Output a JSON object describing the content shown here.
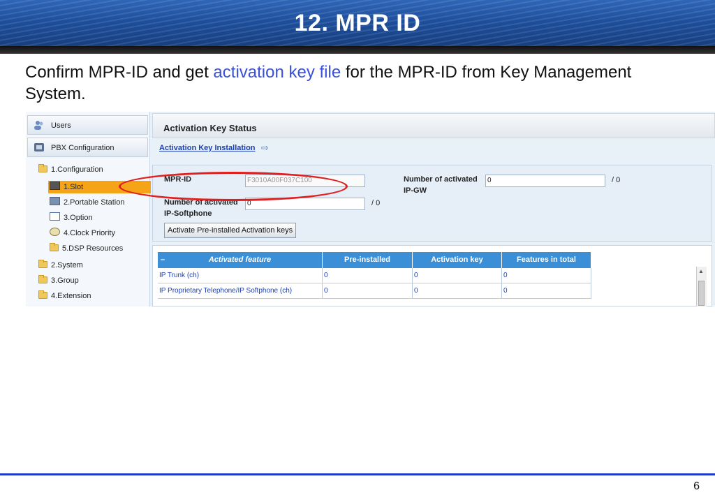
{
  "slide": {
    "title": "12. MPR ID",
    "intro_before": "Confirm MPR-ID and get ",
    "intro_highlight": "activation key file",
    "intro_after": " for the MPR-ID from Key Management System.",
    "page_number": "6"
  },
  "nav": {
    "users": "Users",
    "pbx_config": "PBX Configuration",
    "tree": [
      {
        "label": "1.Configuration",
        "icon": "folder-icon"
      },
      {
        "label": "1.Slot",
        "icon": "slot-icon",
        "selected": true
      },
      {
        "label": "2.Portable Station",
        "icon": "portable-station-icon"
      },
      {
        "label": "3.Option",
        "icon": "option-icon"
      },
      {
        "label": "4.Clock Priority",
        "icon": "clock-priority-icon"
      },
      {
        "label": "5.DSP Resources",
        "icon": "folder-icon"
      },
      {
        "label": "2.System",
        "icon": "folder-icon"
      },
      {
        "label": "3.Group",
        "icon": "folder-icon"
      },
      {
        "label": "4.Extension",
        "icon": "folder-icon"
      }
    ]
  },
  "main": {
    "section_title": "Activation Key Status",
    "install_link": "Activation Key Installation",
    "mpr_id_label": "MPR-ID",
    "mpr_id_value": "F3010A00F037C100",
    "ipgw_label_1": "Number of activated",
    "ipgw_label_2": "IP-GW",
    "ipgw_value": "0",
    "ipgw_total": "/ 0",
    "ipsoft_label_1": "Number of activated",
    "ipsoft_label_2": "IP-Softphone",
    "ipsoft_value": "0",
    "ipsoft_total": "/ 0",
    "activate_button": "Activate Pre-installed Activation keys",
    "table": {
      "headers": [
        "Activated feature",
        "Pre-installed",
        "Activation key",
        "Features in total"
      ],
      "rows": [
        [
          "IP Trunk (ch)",
          "0",
          "0",
          "0"
        ],
        [
          "IP Proprietary Telephone/IP Softphone (ch)",
          "0",
          "0",
          "0"
        ]
      ]
    }
  },
  "colors": {
    "highlight_text": "#3a50d8",
    "annotation": "#e02020",
    "table_header": "#3a8fd6",
    "selected_item": "#f4a416"
  }
}
